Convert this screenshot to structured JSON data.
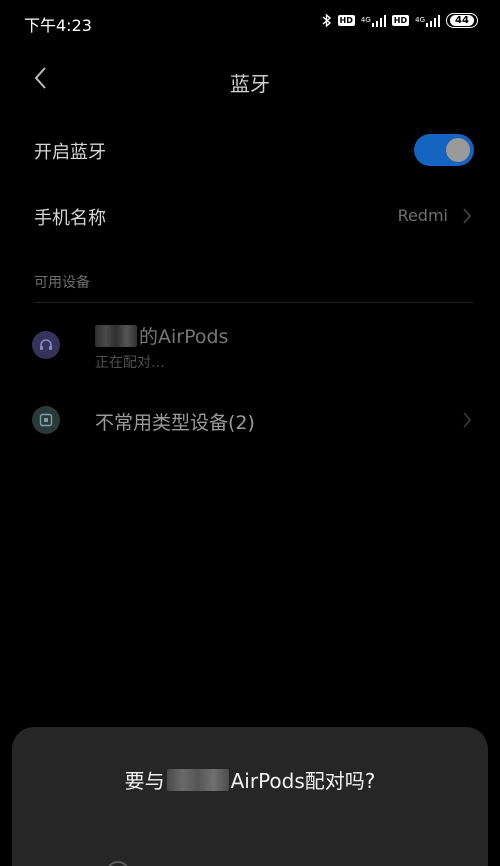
{
  "status_bar": {
    "time": "下午4:23",
    "hd1": "HD",
    "net1": "4G",
    "hd2": "HD",
    "net2": "4G",
    "battery": "44"
  },
  "header": {
    "title": "蓝牙",
    "back_icon": "chevron-left-icon"
  },
  "settings": {
    "enable_bluetooth_label": "开启蓝牙",
    "enable_bluetooth_on": true,
    "phone_name_label": "手机名称",
    "phone_name_value": "Redmi"
  },
  "available_devices": {
    "header": "可用设备",
    "items": [
      {
        "name_suffix": "的AirPods",
        "status": "正在配对…",
        "icon": "headset-icon"
      },
      {
        "name": "不常用类型设备(2)",
        "icon": "device-box-icon"
      }
    ]
  },
  "dialog": {
    "title_prefix": "要与",
    "title_suffix": "AirPods配对吗?"
  },
  "colors": {
    "background": "#000000",
    "accent": "#1564c0",
    "dialog_bg": "#262626"
  }
}
